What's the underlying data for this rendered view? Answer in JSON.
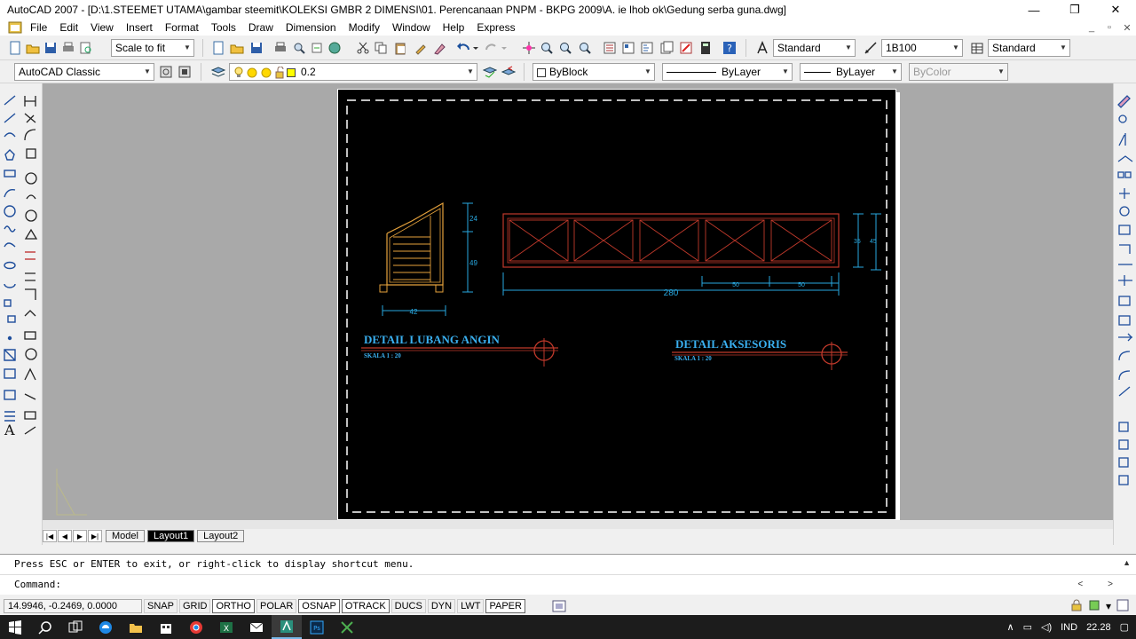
{
  "window": {
    "title": "AutoCAD 2007 - [D:\\1.STEEMET UTAMA\\gambar steemit\\KOLEKSI GMBR 2 DIMENSI\\01. Perencanaan PNPM - BKPG 2009\\A. ie lhob ok\\Gedung serba guna.dwg]",
    "minimize": "—",
    "maximize": "❐",
    "close": "✕"
  },
  "menu": [
    "File",
    "Edit",
    "View",
    "Insert",
    "Format",
    "Tools",
    "Draw",
    "Dimension",
    "Modify",
    "Window",
    "Help",
    "Express"
  ],
  "mdi": {
    "min": "_",
    "restore": "▫",
    "close": "✕"
  },
  "toolbar1": {
    "scale_combo": "Scale to fit",
    "text_style": "Standard",
    "dim_style": "1B100",
    "table_style": "Standard"
  },
  "toolbar2": {
    "workspace": "AutoCAD Classic",
    "layer": "0.2",
    "color": "ByBlock",
    "linetype": "ByLayer",
    "lineweight": "ByLayer",
    "plotstyle": "ByColor"
  },
  "drawing": {
    "left_title": "DETAIL LUBANG ANGIN",
    "left_scale": "SKALA 1 : 20",
    "right_title": "DETAIL AKSESORIS",
    "right_scale": "SKALA 1 : 20",
    "dim_24": "24",
    "dim_49": "49",
    "dim_42": "42",
    "dim_280": "280",
    "dim_50a": "50",
    "dim_50b": "50",
    "dim_35": "35",
    "dim_45": "45"
  },
  "tabs": {
    "model": "Model",
    "layout1": "Layout1",
    "layout2": "Layout2"
  },
  "command": {
    "line1": "Press ESC or ENTER to exit, or right-click to display shortcut menu.",
    "line2": "Command:"
  },
  "status": {
    "coords": "14.9946, -0.2469, 0.0000",
    "buttons": [
      "SNAP",
      "GRID",
      "ORTHO",
      "POLAR",
      "OSNAP",
      "OTRACK",
      "DUCS",
      "DYN",
      "LWT",
      "PAPER"
    ]
  },
  "taskbar": {
    "lang": "IND",
    "time": "22.28"
  },
  "colors": {
    "dim": "#29a8e0",
    "geo": "#c0392b",
    "wood": "#e6a23c",
    "title": "#3ab0f0"
  }
}
